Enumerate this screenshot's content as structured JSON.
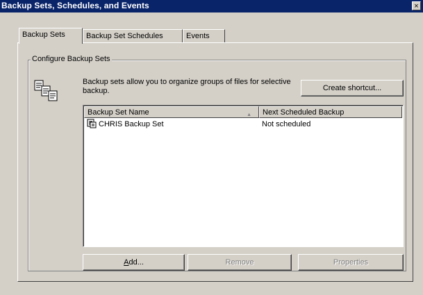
{
  "window": {
    "title": "Backup Sets, Schedules, and Events",
    "close_glyph": "×"
  },
  "tabs": [
    {
      "label": "Backup Sets",
      "active": true
    },
    {
      "label": "Backup Set Schedules",
      "active": false
    },
    {
      "label": "Events",
      "active": false
    }
  ],
  "group": {
    "legend": "Configure Backup Sets",
    "description": "Backup sets allow you to organize groups of files for selective backup.",
    "icon": "backup-sets-icon"
  },
  "buttons": {
    "create_shortcut": "Create shortcut...",
    "add_prefix": "",
    "add_mnemonic": "A",
    "add_rest": "dd...",
    "remove": "Remove",
    "properties": "Properties"
  },
  "list": {
    "columns": [
      {
        "label": "Backup Set Name",
        "sorted": "ascending"
      },
      {
        "label": "Next Scheduled Backup"
      }
    ],
    "rows": [
      {
        "name": "CHRIS Backup Set",
        "next": "Not scheduled",
        "icon": "backup-set-icon"
      }
    ]
  }
}
